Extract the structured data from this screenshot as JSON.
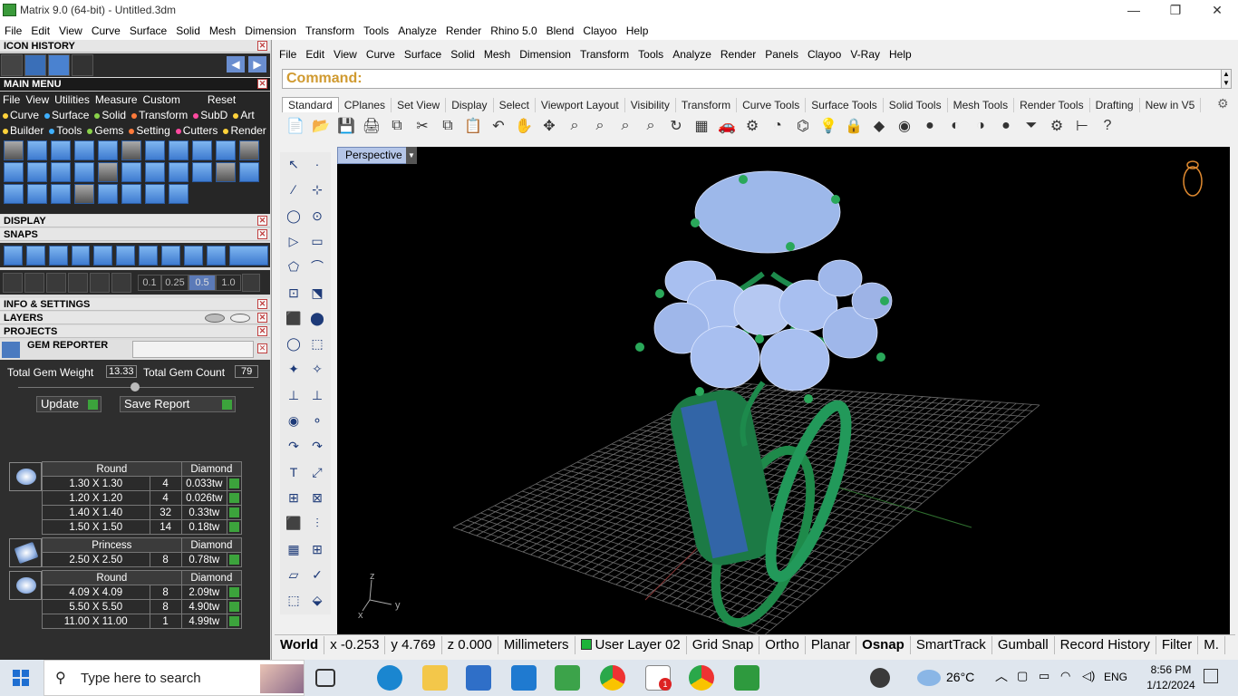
{
  "window": {
    "title": "Matrix 9.0 (64-bit) - Untitled.3dm",
    "min": "—",
    "max": "❐",
    "close": "✕"
  },
  "menubar": [
    "File",
    "Edit",
    "View",
    "Curve",
    "Surface",
    "Solid",
    "Mesh",
    "Dimension",
    "Transform",
    "Tools",
    "Analyze",
    "Render",
    "Rhino 5.0",
    "Blend",
    "Clayoo",
    "Help"
  ],
  "left": {
    "icon_history": "ICON HISTORY",
    "main_menu": "MAIN MENU",
    "main_menu_row1": [
      "File",
      "View",
      "Utilities",
      "Measure",
      "Custom",
      "Reset"
    ],
    "main_menu_row2": [
      "Curve",
      "Surface",
      "Solid",
      "Transform",
      "SubD",
      "Art"
    ],
    "main_menu_row3": [
      "Builder",
      "Tools",
      "Gems",
      "Setting",
      "Cutters",
      "Render"
    ],
    "display": "DISPLAY",
    "snaps": "SNAPS",
    "snap_values": [
      "0.1",
      "0.25",
      "0.5",
      "1.0"
    ],
    "info_settings": "INFO & SETTINGS",
    "layers": "LAYERS",
    "projects": "PROJECTS",
    "gem_reporter": "GEM REPORTER",
    "total_weight_label": "Total Gem Weight",
    "total_weight": "13.33",
    "total_count_label": "Total Gem Count",
    "total_count": "79",
    "update": "Update",
    "save_report": "Save Report",
    "groups": [
      {
        "shape": "Round",
        "type": "Diamond",
        "rows": [
          [
            "1.30 X 1.30",
            "4",
            "0.033tw"
          ],
          [
            "1.20 X 1.20",
            "4",
            "0.026tw"
          ],
          [
            "1.40 X 1.40",
            "32",
            "0.33tw"
          ],
          [
            "1.50 X 1.50",
            "14",
            "0.18tw"
          ]
        ]
      },
      {
        "shape": "Princess",
        "type": "Diamond",
        "rows": [
          [
            "2.50 X 2.50",
            "8",
            "0.78tw"
          ]
        ]
      },
      {
        "shape": "Round",
        "type": "Diamond",
        "rows": [
          [
            "4.09 X 4.09",
            "8",
            "2.09tw"
          ],
          [
            "5.50 X 5.50",
            "8",
            "4.90tw"
          ],
          [
            "11.00 X 11.00",
            "1",
            "4.99tw"
          ]
        ]
      }
    ]
  },
  "rhino": {
    "menu": [
      "File",
      "Edit",
      "View",
      "Curve",
      "Surface",
      "Solid",
      "Mesh",
      "Dimension",
      "Transform",
      "Tools",
      "Analyze",
      "Render",
      "Panels",
      "Clayoo",
      "V-Ray",
      "Help"
    ],
    "command": "Command:",
    "tabs": [
      "Standard",
      "CPlanes",
      "Set View",
      "Display",
      "Select",
      "Viewport Layout",
      "Visibility",
      "Transform",
      "Curve Tools",
      "Surface Tools",
      "Solid Tools",
      "Mesh Tools",
      "Render Tools",
      "Drafting",
      "New in V5"
    ],
    "viewport_label": "Perspective",
    "axis_z": "z",
    "axis_y": "y",
    "axis_x": "x"
  },
  "status": [
    "World",
    "x -0.253",
    "y 4.769",
    "z 0.000",
    "Millimeters",
    "User Layer 02",
    "Grid Snap",
    "Ortho",
    "Planar",
    "Osnap",
    "SmartTrack",
    "Gumball",
    "Record History",
    "Filter",
    "M."
  ],
  "taskbar": {
    "search": "Type here to search",
    "temp": "26°C",
    "lang": "ENG",
    "time": "8:56 PM",
    "date": "1/12/2024",
    "badge": "1"
  }
}
